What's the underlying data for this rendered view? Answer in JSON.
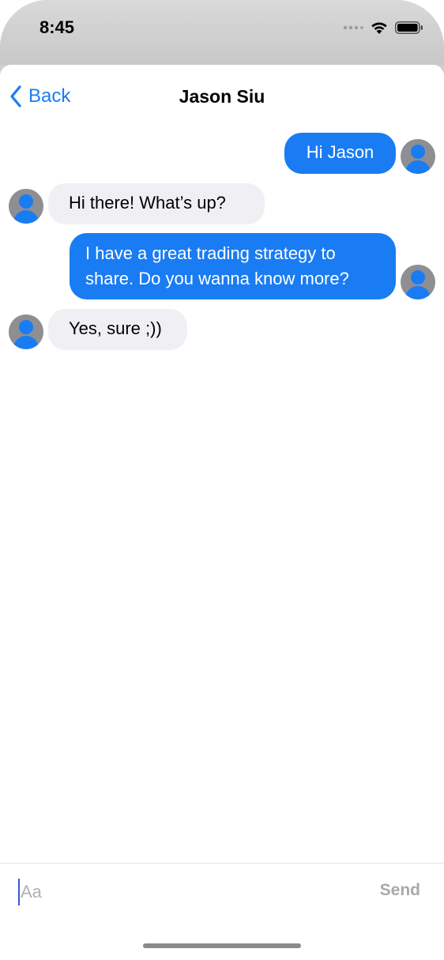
{
  "status_bar": {
    "time": "8:45",
    "signal_icon": "cellular-dots-icon",
    "wifi_icon": "wifi-icon",
    "battery_icon": "battery-icon"
  },
  "nav": {
    "back_label": "Back",
    "back_icon": "chevron-left-icon",
    "title": "Jason Siu"
  },
  "messages": [
    {
      "direction": "outgoing",
      "lines": [
        "Hi Jason"
      ]
    },
    {
      "direction": "incoming",
      "lines": [
        "Hi there! What’s up?"
      ]
    },
    {
      "direction": "outgoing",
      "lines": [
        "I have a great trading strategy to",
        "share. Do you wanna know more?"
      ]
    },
    {
      "direction": "incoming",
      "lines": [
        "Yes, sure ;))"
      ]
    }
  ],
  "composer": {
    "placeholder": "Aa",
    "value": "",
    "send_label": "Send"
  },
  "colors": {
    "accent": "#1a7cf3",
    "incoming_bubble": "#f0f0f4",
    "avatar_bg": "#8e8e93",
    "send_disabled": "#a8a8ad"
  }
}
